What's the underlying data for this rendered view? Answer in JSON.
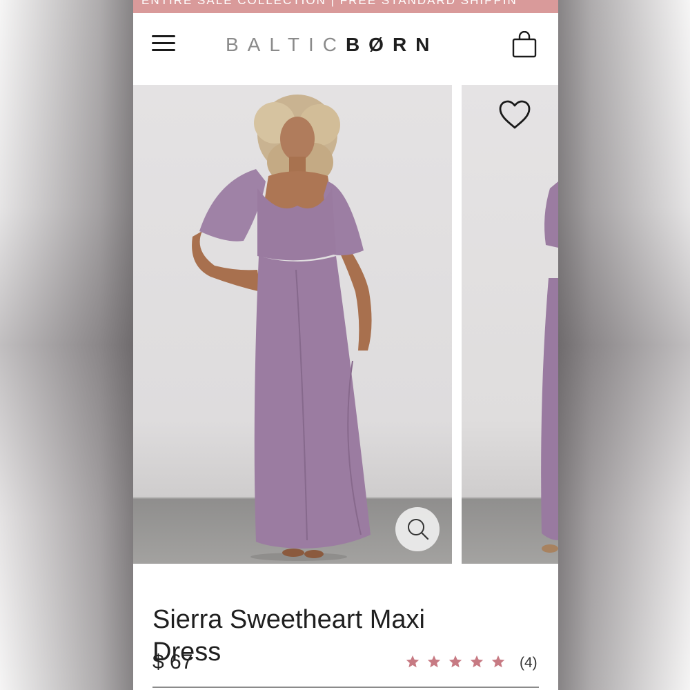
{
  "promo_banner": {
    "text": "ENTIRE SALE COLLECTION | FREE STANDARD SHIPPIN"
  },
  "header": {
    "logo_part1": "BALTIC",
    "logo_part2": "BØRN",
    "menu_icon": "hamburger-menu-icon",
    "cart_icon": "shopping-bag-icon"
  },
  "gallery": {
    "images": [
      {
        "alt": "Sierra Sweetheart Maxi Dress front view"
      },
      {
        "alt": "Sierra Sweetheart Maxi Dress side view"
      }
    ],
    "zoom_icon": "magnifier-icon",
    "wishlist_icon": "heart-icon"
  },
  "product": {
    "title": "Sierra Sweetheart Maxi Dress",
    "price": "$ 67",
    "rating": {
      "stars": 5,
      "review_count": "(4)"
    }
  },
  "colors": {
    "promo_bar": "#d99a9a",
    "star": "#c77a83",
    "dress": "#9a7ba0"
  }
}
